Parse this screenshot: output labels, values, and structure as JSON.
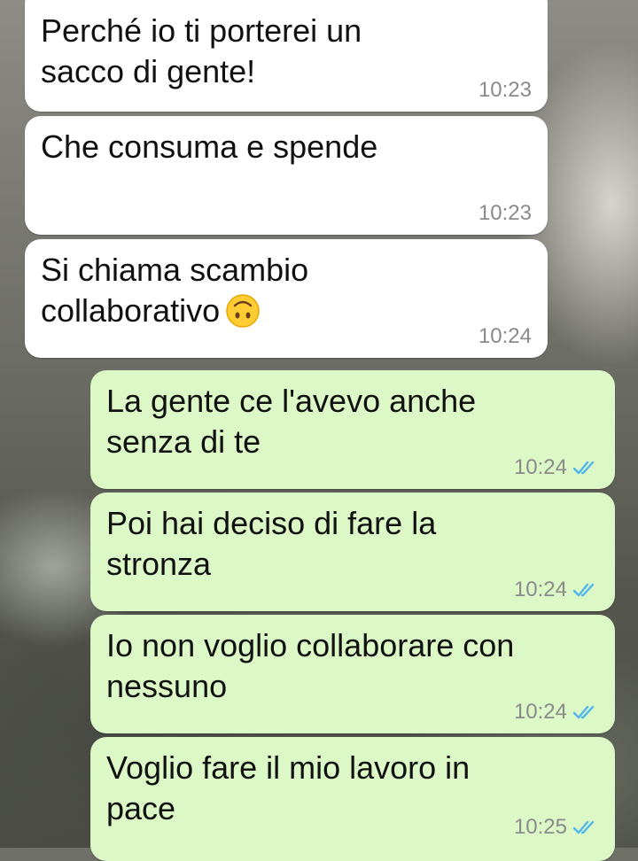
{
  "chat": {
    "messages": [
      {
        "direction": "incoming",
        "text": "Perché io ti porterei un\nsacco di gente!",
        "time": "10:23"
      },
      {
        "direction": "incoming",
        "text": "Che consuma e spende",
        "time": "10:23"
      },
      {
        "direction": "incoming",
        "text": "Si chiama scambio\ncollaborativo",
        "emoji": "upside-down-face",
        "time": "10:24"
      },
      {
        "direction": "outgoing",
        "text": "La gente ce l'avevo anche\nsenza di te",
        "time": "10:24",
        "status": "read-double-check-icon"
      },
      {
        "direction": "outgoing",
        "text": "Poi hai deciso di fare la\nstronza",
        "time": "10:24",
        "status": "read-double-check-icon"
      },
      {
        "direction": "outgoing",
        "text": "Io non voglio collaborare con\nnessuno",
        "time": "10:24",
        "status": "read-double-check-icon"
      },
      {
        "direction": "outgoing",
        "text": "Voglio fare il mio lavoro in\npace",
        "time": "10:25",
        "status": "read-double-check-icon"
      }
    ]
  },
  "colors": {
    "incoming_bubble": "#ffffff",
    "outgoing_bubble": "#dcf8c6",
    "read_tick": "#4fb6ec",
    "timestamp": "#8a8a8a"
  }
}
